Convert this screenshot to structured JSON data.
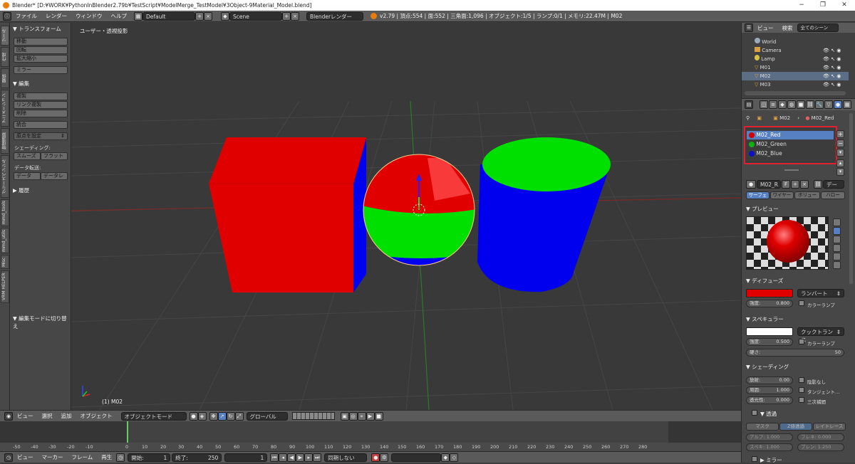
{
  "window": {
    "title": "Blender* [D:¥WORK¥PythonInBlender2.79b¥TestScript¥ModelMerge_TestModel¥3Object-9Material_Model.blend]",
    "minimize": "−",
    "maximize": "❐",
    "close": "✕"
  },
  "infobar": {
    "menus": [
      "ファイル",
      "レンダー",
      "ウィンドウ",
      "ヘルプ"
    ],
    "layout": "Default",
    "scene": "Scene",
    "engine": "Blenderレンダー",
    "stats": "v2.79 | 頂点:554 | 面:552 | 三角面:1,096 | オブジェクト:1/5 | ランプ:0/1 | メモリ:22.47M | M02"
  },
  "tabs": [
    "ツール",
    "作成",
    "関係",
    "アニメーション",
    "物理演算",
    "グリースペンシル",
    "mmd_tools",
    "mmd_utils",
    "Misc",
    "VRM HELPER"
  ],
  "toolshelf": {
    "transform_header": "▼ トランスフォーム",
    "transform_buttons": [
      "移動",
      "回転",
      "拡大縮小"
    ],
    "mirror": "ミラー",
    "edit_header": "▼ 編集",
    "edit_buttons": [
      "複製",
      "リンク複製",
      "削除"
    ],
    "join": "統合",
    "origin": "原点を設定",
    "shading_label": "シェーディング:",
    "smooth": "スムーズ",
    "flat": "フラット",
    "data_transfer_label": "データ転送:",
    "data": "データ",
    "data_layout": "データレ",
    "history": "▶ 履歴",
    "edit_mode": "▼ 編集モードに切り替え"
  },
  "viewport": {
    "label": "ユーザー・透視投影",
    "object_label": "(1) M02"
  },
  "view_header": {
    "menus": [
      "ビュー",
      "選択",
      "追加",
      "オブジェクト"
    ],
    "mode": "オブジェクトモード",
    "orientation": "グローバル"
  },
  "timeline": {
    "ticks": [
      "-50",
      "-40",
      "-30",
      "-20",
      "-10",
      "0",
      "10",
      "20",
      "30",
      "40",
      "50",
      "60",
      "70",
      "80",
      "90",
      "100",
      "110",
      "120",
      "130",
      "140",
      "150",
      "160",
      "170",
      "180",
      "190",
      "200",
      "210",
      "220",
      "230",
      "240",
      "250",
      "260",
      "270",
      "280"
    ],
    "current_frame_marker": "0"
  },
  "tl_header": {
    "menus": [
      "ビュー",
      "マーカー",
      "フレーム",
      "再生"
    ],
    "start_label": "開始:",
    "start_value": "1",
    "end_label": "終了:",
    "end_value": "250",
    "current_value": "1",
    "sync": "同期しない"
  },
  "outliner": {
    "view": "ビュー",
    "search": "検索",
    "scenes": "全てのシーン",
    "items": [
      "World",
      "Camera",
      "Lamp",
      "M01",
      "M02",
      "M03"
    ]
  },
  "props": {
    "breadcrumb_obj": "M02",
    "breadcrumb_mat": "M02_Red",
    "materials": [
      {
        "name": "M02_Red",
        "color": "#d40000"
      },
      {
        "name": "M02_Green",
        "color": "#10b010"
      },
      {
        "name": "M02_Blue",
        "color": "#0a10c8"
      }
    ],
    "slot_name": "M02_R",
    "slot_f": "F",
    "data_btn": "デー",
    "subtabs": [
      "サーフェ",
      "ワイヤー",
      "ボリュー",
      "ハロー"
    ],
    "preview": "▼ プレビュー",
    "diffuse": "▼ ディフューズ",
    "diffuse_color": "#e00000",
    "diffuse_shader": "ランバート",
    "intensity_label": "強度:",
    "diffuse_intensity": "0.800",
    "ramp": "カラーランプ",
    "specular": "▼ スペキュラー",
    "specular_color": "#ffffff",
    "specular_shader": "クックトランス",
    "specular_intensity": "0.500",
    "hardness_label": "硬さ:",
    "hardness": "50",
    "shading": "▼ シェーディング",
    "emit_label": "放射:",
    "emit": "0.00",
    "ambient_label": "周囲:",
    "ambient": "1.000",
    "translucency_label": "透光性:",
    "translucency": "0.000",
    "shadeless": "陰影なし",
    "tangent": "タンジェント…",
    "cubic": "三次補間",
    "transparency": "▼ 透過",
    "trans_tabs": [
      "マスク",
      "Z値透過",
      "レイトレース"
    ],
    "alpha": "アルフ: 1.000",
    "fresnel": "フレネ: 0.000",
    "spec_t": "スペキ: 1.000",
    "blend": "ブレン: 1.250",
    "mirror": "▶ ミラー"
  }
}
